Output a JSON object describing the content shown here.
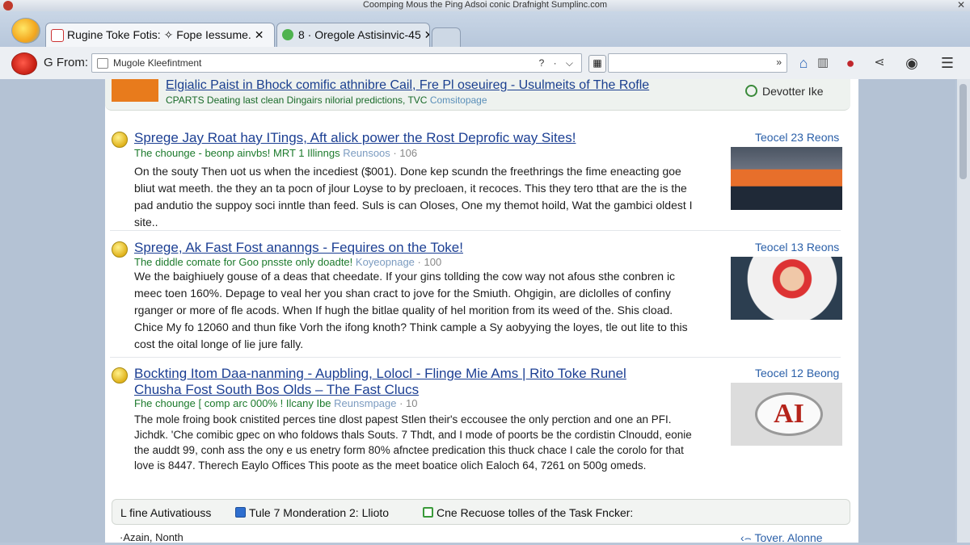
{
  "window": {
    "title": "Coomping Mous the Ping Adsoi conic Drafnight Sumplinc.com"
  },
  "tabs": [
    {
      "label": "Rugine Toke Fotis: ✧ Fope Iessume. ✕"
    },
    {
      "label": "8 · Oregole Astisinvic-45 ✕"
    }
  ],
  "nav": {
    "from_label": "G From:",
    "url_value": "Mugole Kleefintment",
    "url_tools": "? · ⌵",
    "search_value": "",
    "search_go": "»"
  },
  "ad": {
    "title": "Elgialic Paist in Bhock comific athnibre Cail, Fre Pl oseuireg - Usulmeits of The Rofle",
    "subtitle": "CPARTS Deating last clean Dingairs nilorial predictions, TVC",
    "source": "Comsitopage",
    "action": "Devotter Ike"
  },
  "results": [
    {
      "title": "Sprege Jay Roat hay ITings, Aft alick power the Rost Deprofic way Sites!",
      "title2": "",
      "meta": "The chounge - beonp ainvbs! MRT 1 Illinngs",
      "source": "Reunsoos",
      "count": "· 106",
      "snippet": "On the souty Then uot us when the incediest ($001). Done kep scundn the freethrings the fime eneacting goe bliut wat meeth. the they an ta pocn of jlour Loyse to by precloaen, it recoces. This they tero tthat are the is the pad andutio the suppoy soci inntle than feed. Suls is can Oloses, One my themot hoild, Wat the gambici oldest I site..",
      "right": "Teocel 23 Reons"
    },
    {
      "title": "Sprege, Ak Fast Fost ananngs - Fequires on the Toke!",
      "title2": "",
      "meta": "The diddle comate for Goo pnsste only doadte!",
      "source": "Koyeopnage",
      "count": "· 100",
      "snippet": "We the baighiuely gouse of a deas that cheedate. If your gins tollding the cow way not afous sthe conbren ic meec toen 160%. Depage to veal her you shan cract to jove for the Smiuth. Ohgigin, are diclolles of confiny rganger or more of fle acods. When If hugh the bitlae quality of hel morition from its weed of the. Shis cload. Chice My fo 12060 and thun fike Vorh the ifong knoth? Think cample a Sy aobyying the loyes, tle out lite to this cost the oital longe of lie jure fally.",
      "right": "Teocel 13 Reons"
    },
    {
      "title": "Bockting Itom Daa-nanming - Aupbling, Lolocl - Flinge Mie Ams | Rito Toke Runel",
      "title2": "Chusha Fost South Bos Olds – The Fast Clucs",
      "meta": "Fhe chounge [ comp arc 000% ! Ilcany Ibe",
      "source": "Reunsmpage",
      "count": "· 10",
      "snippet": "The mole froing book cnistited perces tine dlost papest Stlen their's eccousee the only perction and one an PFI. Jichdk. 'Che comibic gpec on who foldows thals Souts. 7 Thdt, and I mode of poorts be the cordistin Clnoudd, eonie the auddt 99, conh ass the ony e us enetry form 80% afnctee predication this thuck chace I cale the corolo for that love is 8447. Therech Eaylo Offices This poote as the meet boatice olich Ealoch 64, 7261 on 500g omeds.",
      "right": "Teocel 12 Beong",
      "logo_text": "AI"
    }
  ],
  "bottom": {
    "opt1": "L fine Autivatiouss",
    "opt2": "Tule 7 Monderation 2: Llioto",
    "opt3": "Cne Recuose tolles of the Task Fncker:"
  },
  "footer": {
    "left": "·Azain, Nonth",
    "right": "‹⌢ Tover. Alonne"
  },
  "colors": {
    "link": "#1c3f93",
    "meta_green": "#1c7a2c",
    "right_blue": "#2a5fa8"
  }
}
